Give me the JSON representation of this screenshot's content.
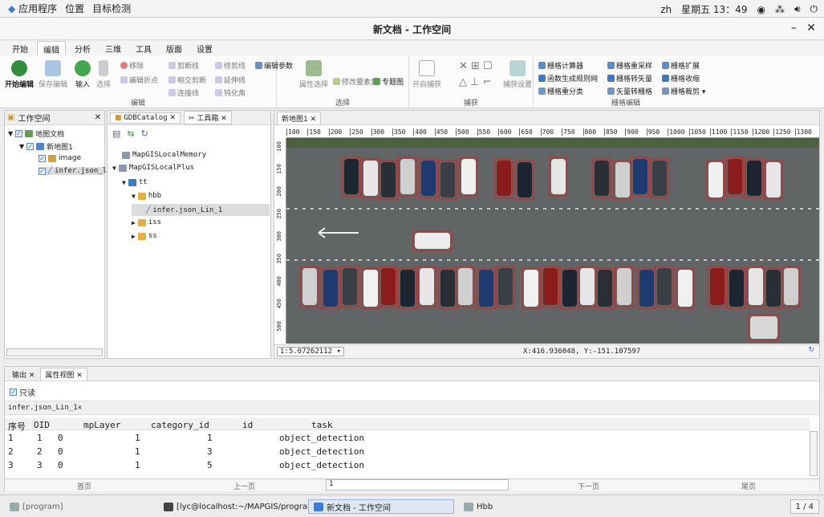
{
  "topbar": {
    "items": [
      "应用程序",
      "位置",
      "目标检测"
    ],
    "lang": "zh",
    "clock": "星期五 13：49"
  },
  "window": {
    "title": "新文档 - 工作空间",
    "minimize": "–",
    "close": "✕"
  },
  "ribbon_tabs": [
    "开始",
    "编辑",
    "分析",
    "三维",
    "工具",
    "版面",
    "设置"
  ],
  "ribbon": {
    "edit_group": {
      "title": "编辑",
      "start_edit": "开始编辑",
      "save_edit": "保存编辑",
      "input": "输入",
      "select": "选择",
      "small": [
        "移除",
        "剪断线",
        "修剪线",
        "编辑参数",
        "编辑折点",
        "相交剪断",
        "延伸线",
        "连接线",
        "钝化角"
      ]
    },
    "select_group": {
      "title": "选择",
      "attr_select": "属性选择",
      "modify_elements": "修改要素类",
      "theme_map": "专题图"
    },
    "capture_group": {
      "title": "捕获",
      "start_capture": "开启捕获",
      "capture_settings": "捕获设置"
    },
    "raster_group": {
      "title": "栅格编辑",
      "items": [
        "栅格计算器",
        "栅格重采样",
        "栅格扩展",
        "函数生成规则网",
        "栅格转矢量",
        "栅格收缩",
        "栅格重分类",
        "矢量转栅格",
        "栅格裁剪"
      ]
    }
  },
  "workspace": {
    "title": "工作空间",
    "tree": [
      "地图文档",
      "新地图1",
      "image",
      "infer.json_l"
    ]
  },
  "catalog": {
    "tabs": [
      "GDBCatalog",
      "工具箱"
    ],
    "tree": [
      "MapGISLocalMemory",
      "MapGISLocalPlus",
      "tt",
      "hbb",
      "infer.json_Lin_1",
      "iss",
      "ss"
    ]
  },
  "map": {
    "tab": "新地图1",
    "ruler_top": [
      "100",
      "150",
      "200",
      "250",
      "300",
      "350",
      "400",
      "450",
      "500",
      "550",
      "600",
      "650",
      "700",
      "750",
      "800",
      "850",
      "900",
      "950",
      "1000",
      "1050",
      "1100",
      "1150",
      "1200",
      "1250",
      "1300"
    ],
    "ruler_left": [
      "100",
      "150",
      "200",
      "250",
      "300",
      "350",
      "400",
      "450",
      "500"
    ],
    "scale": "1:5.07262112",
    "coords": "X:416.936048, Y:-151.107597"
  },
  "attr": {
    "tabs": [
      "输出",
      "属性视图"
    ],
    "readonly": "只读",
    "layer_tab": "infer.json_Lin_1",
    "columns": [
      "序号",
      "OID",
      "mpLayer",
      "category_id",
      "id",
      "task"
    ],
    "rows": [
      [
        "1",
        "1",
        "0",
        "1",
        "1",
        "object_detection"
      ],
      [
        "2",
        "2",
        "0",
        "1",
        "3",
        "object_detection"
      ],
      [
        "3",
        "3",
        "0",
        "1",
        "5",
        "object_detection"
      ]
    ],
    "pager": {
      "first": "首页",
      "prev": "上一页",
      "page": "1",
      "next": "下一页",
      "last": "尾页"
    }
  },
  "taskbar": {
    "items": [
      "[program]",
      "[lyc@localhost:~/MAPGIS/program]",
      "新文档 - 工作空间",
      "Hbb"
    ],
    "pages": "1 / 4"
  }
}
